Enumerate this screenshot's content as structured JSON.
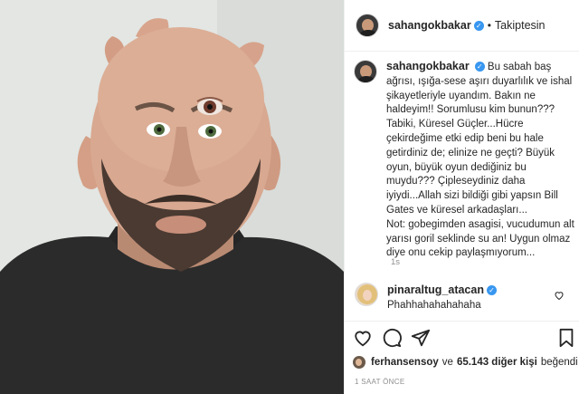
{
  "post": {
    "username": "sahangokbakar",
    "follow_status": "Takiptesin",
    "separator": "•",
    "caption": "Bu sabah baş ağrısı, ışığa-sese aşırı duyarlılık ve ishal şikayetleriyle uyandım. Bakın ne haldeyim!! Sorumlusu kim bunun??? Tabiki, Küresel Güçler...Hücre çekirdeğime etki edip beni bu hale getirdiniz de; elinize ne geçti? Büyük oyun, büyük oyun dediğiniz bu muydu??? Çipleseydiniz daha iyiydi...Allah sizi bildiği gibi yapsın Bill Gates ve küresel arkadaşları...",
    "caption_note": "Not: gobegimden asagisi, vucudumun alt yarısı goril seklinde su an! Uygun olmaz diye onu cekip paylaşmıyorum...",
    "caption_time": "1s"
  },
  "comment": {
    "username": "pinaraltug_atacan",
    "text": "Phahhahahahahaha"
  },
  "likes": {
    "liker": "ferhansensoy",
    "joiner": "ve",
    "others": "65.143 diğer kişi",
    "suffix": "beğendi"
  },
  "posted_ago": "1 SAAT ÖNCE",
  "icons": {
    "verified": "verified-badge-icon",
    "like": "heart-icon",
    "comment": "comment-icon",
    "share": "paper-plane-icon",
    "save": "bookmark-icon"
  },
  "colors": {
    "verified": "#3897f0",
    "muted": "#8e8e8e"
  }
}
